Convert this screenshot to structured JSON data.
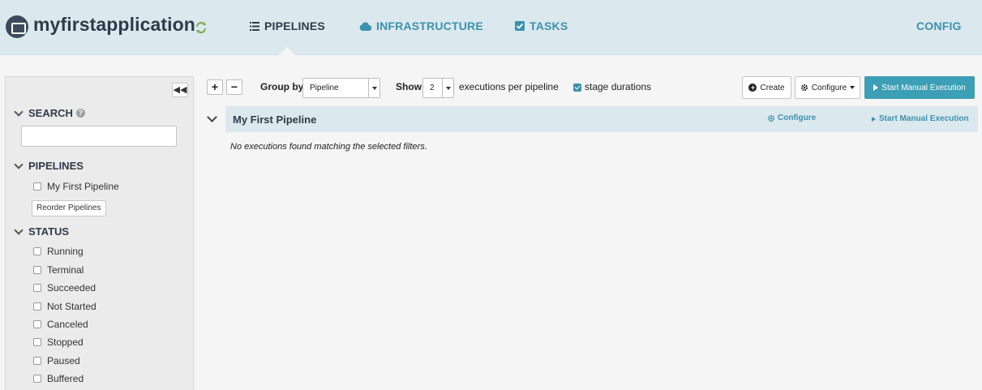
{
  "header": {
    "app_title": "myfirstapplication",
    "nav": {
      "pipelines": "PIPELINES",
      "infrastructure": "INFRASTRUCTURE",
      "tasks": "TASKS",
      "config": "CONFIG"
    },
    "colors": {
      "header_bg": "#dbe8ee",
      "active_nav": "#2f3b4a",
      "link_nav": "#3c92ad"
    }
  },
  "sidebar": {
    "search": {
      "title": "SEARCH",
      "value": "",
      "placeholder": ""
    },
    "pipelines": {
      "title": "PIPELINES",
      "items": [
        {
          "label": "My First Pipeline",
          "checked": false
        }
      ],
      "reorder_label": "Reorder Pipelines"
    },
    "status": {
      "title": "STATUS",
      "items": [
        {
          "label": "Running",
          "checked": false
        },
        {
          "label": "Terminal",
          "checked": false
        },
        {
          "label": "Succeeded",
          "checked": false
        },
        {
          "label": "Not Started",
          "checked": false
        },
        {
          "label": "Canceled",
          "checked": false
        },
        {
          "label": "Stopped",
          "checked": false
        },
        {
          "label": "Paused",
          "checked": false
        },
        {
          "label": "Buffered",
          "checked": false
        }
      ]
    }
  },
  "toolbar": {
    "expand_label": "+",
    "collapse_label": "−",
    "group_by_label": "Group by",
    "group_by_value": "Pipeline",
    "show_label": "Show",
    "show_value": "2",
    "executions_label": "executions per pipeline",
    "stage_durations_label": "stage durations",
    "stage_durations_checked": true,
    "create_label": "Create",
    "configure_label": "Configure",
    "start_manual_label": "Start Manual Execution",
    "primary_color": "#3c9fb5"
  },
  "pipeline": {
    "name": "My First Pipeline",
    "configure_label": "Configure",
    "start_manual_label": "Start Manual Execution",
    "empty_message": "No executions found matching the selected filters."
  }
}
